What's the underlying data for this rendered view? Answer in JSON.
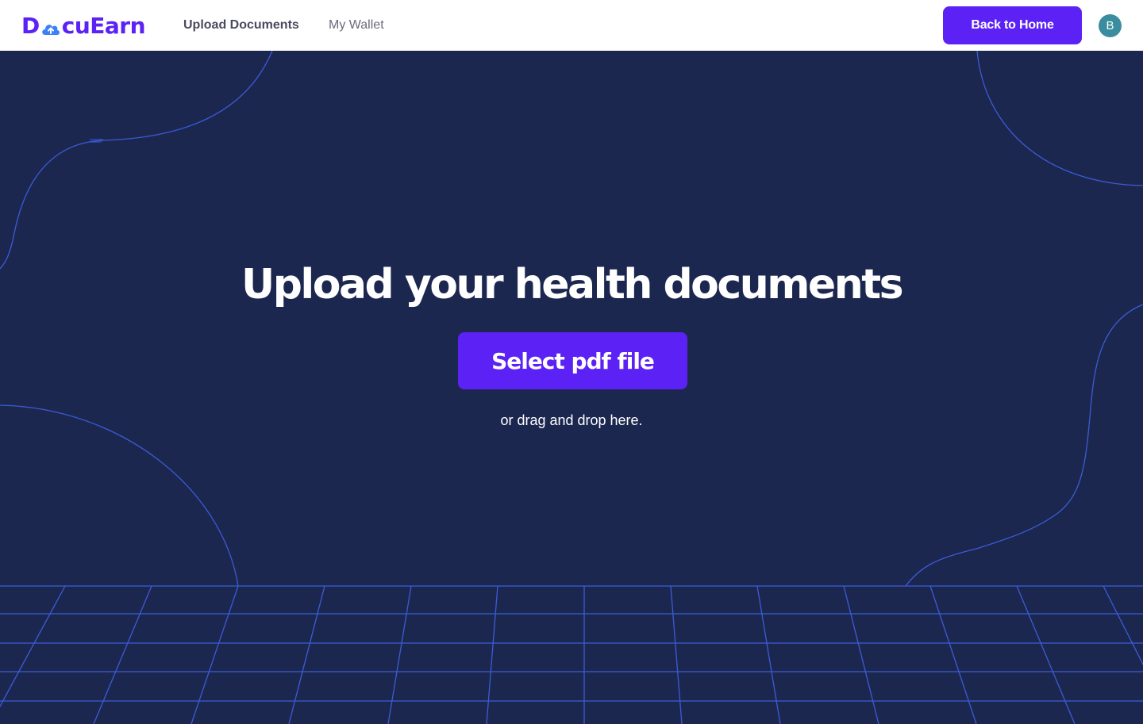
{
  "header": {
    "logo": {
      "prefix": "D",
      "suffix": "cuEarn",
      "icon": "cloud-upload-icon"
    },
    "nav": {
      "upload": "Upload Documents",
      "wallet": "My Wallet"
    },
    "back_home": "Back to Home",
    "avatar_initial": "B"
  },
  "hero": {
    "headline": "Upload your health documents",
    "select_button": "Select pdf file",
    "drop_hint": "or drag and drop here."
  },
  "colors": {
    "brand": "#5b21f5",
    "background": "#1c2750",
    "lines": "#3b5bd6",
    "avatar": "#3a8d9e"
  }
}
